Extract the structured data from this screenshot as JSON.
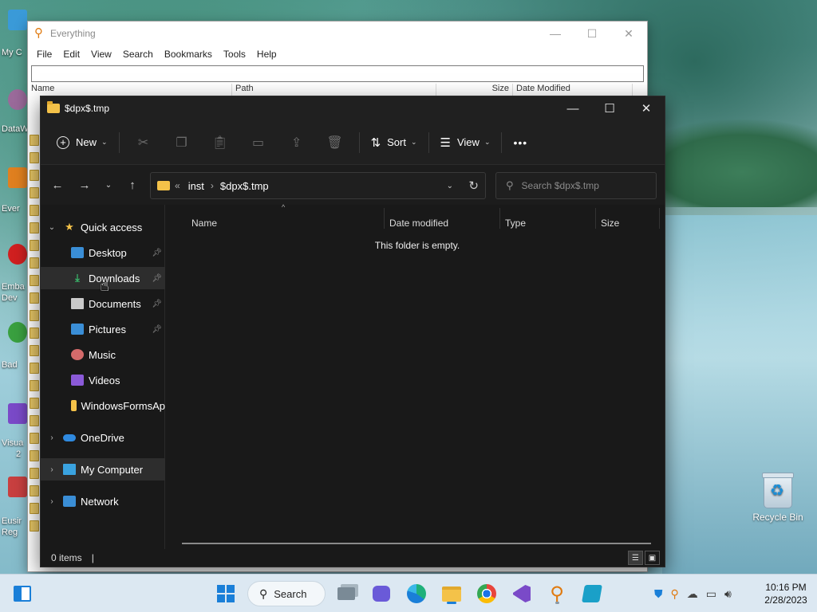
{
  "desktop": {
    "recycle_bin_label": "Recycle Bin",
    "left_labels": [
      "My C",
      "DataW",
      "Ever",
      "Emba",
      "Dev",
      "Bad",
      "Visua",
      "2",
      "Eusir",
      "Reg"
    ]
  },
  "everything_window": {
    "title": "Everything",
    "menu": [
      "File",
      "Edit",
      "View",
      "Search",
      "Bookmarks",
      "Tools",
      "Help"
    ],
    "columns": [
      "Name",
      "Path",
      "Size",
      "Date Modified"
    ],
    "search_value": ""
  },
  "explorer": {
    "title": "$dpx$.tmp",
    "toolbar": {
      "new_label": "New",
      "sort_label": "Sort",
      "view_label": "View",
      "more_label": "•••"
    },
    "address": {
      "overflow": "«",
      "crumbs": [
        "inst",
        "$dpx$.tmp"
      ]
    },
    "search_placeholder": "Search $dpx$.tmp",
    "nav": {
      "quick_access": "Quick access",
      "items": [
        {
          "label": "Desktop",
          "pinned": true
        },
        {
          "label": "Downloads",
          "pinned": true
        },
        {
          "label": "Documents",
          "pinned": true
        },
        {
          "label": "Pictures",
          "pinned": true
        },
        {
          "label": "Music",
          "pinned": false
        },
        {
          "label": "Videos",
          "pinned": false
        },
        {
          "label": "WindowsFormsAp",
          "pinned": false
        }
      ],
      "onedrive": "OneDrive",
      "my_computer": "My Computer",
      "network": "Network"
    },
    "columns": [
      "Name",
      "Date modified",
      "Type",
      "Size"
    ],
    "empty_message": "This folder is empty.",
    "status": {
      "item_count": "0 items",
      "separator": "|"
    }
  },
  "taskbar": {
    "search_label": "Search",
    "time": "10:16 PM",
    "date": "2/28/2023"
  },
  "colors": {
    "accent": "#1a7fd8",
    "explorer_bg": "#191919",
    "folder_yellow": "#f4c249",
    "taskbar_bg": "#dce8f2"
  }
}
